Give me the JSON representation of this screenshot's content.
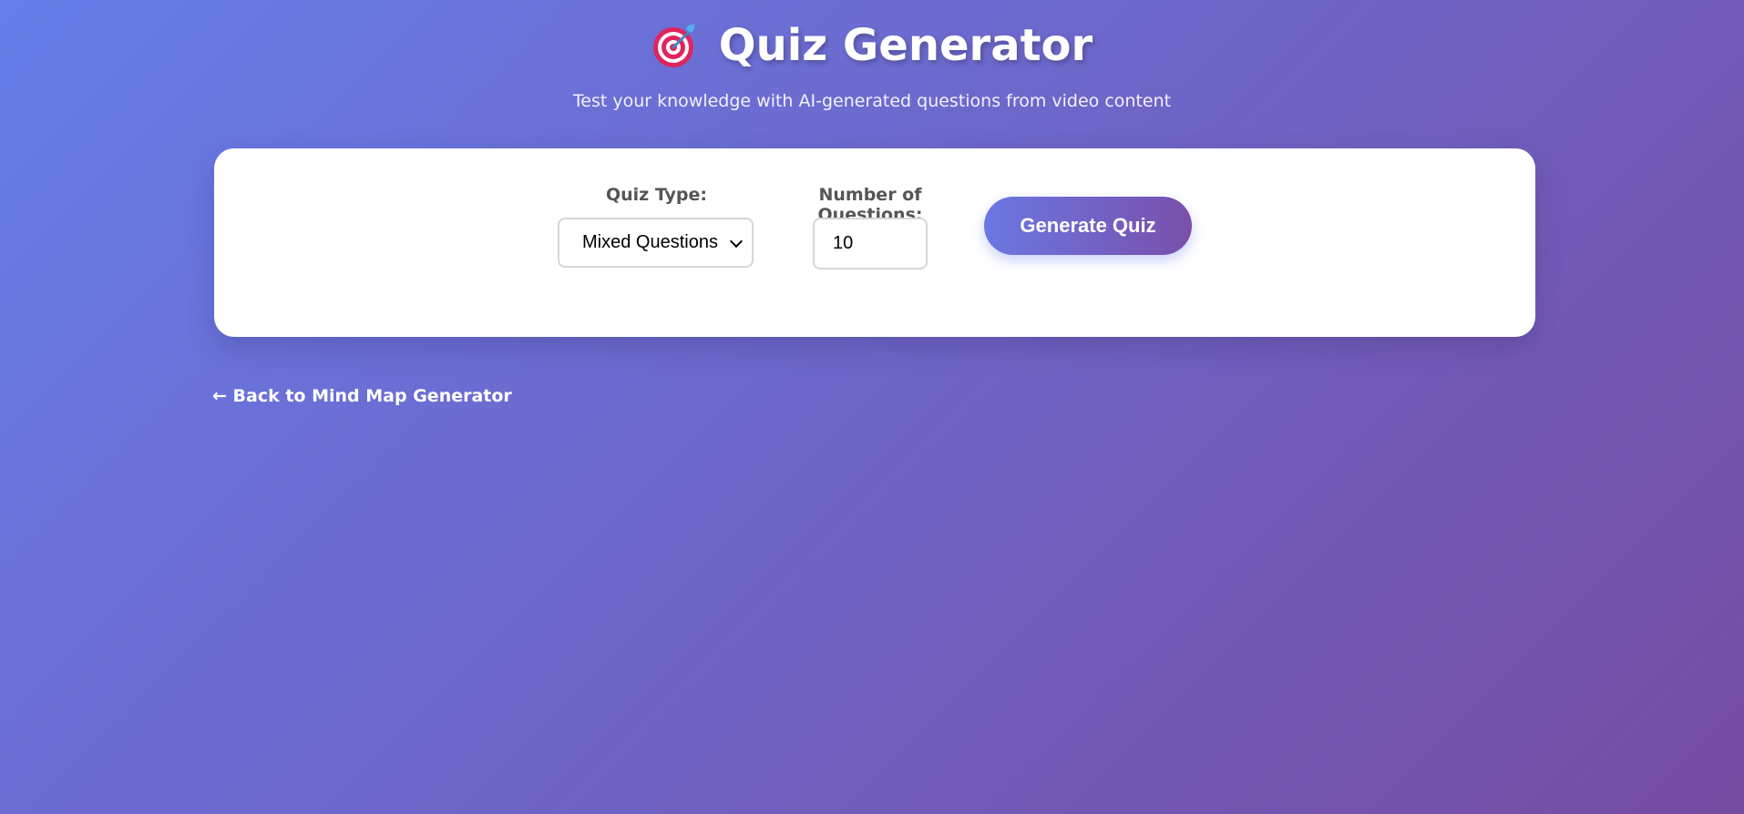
{
  "header": {
    "icon": "target-dart-icon",
    "title": "Quiz Generator",
    "subtitle": "Test your knowledge with AI-generated questions from video content"
  },
  "form": {
    "quiz_type_label": "Quiz Type:",
    "quiz_type_value": "Mixed Questions",
    "num_questions_label": "Number of Questions:",
    "num_questions_value": "10",
    "generate_label": "Generate Quiz"
  },
  "nav": {
    "back_label": "← Back to Mind Map Generator"
  },
  "colors": {
    "gradient_start": "#667eea",
    "gradient_end": "#764ba2",
    "card_bg": "#ffffff",
    "label_color": "#555555"
  }
}
